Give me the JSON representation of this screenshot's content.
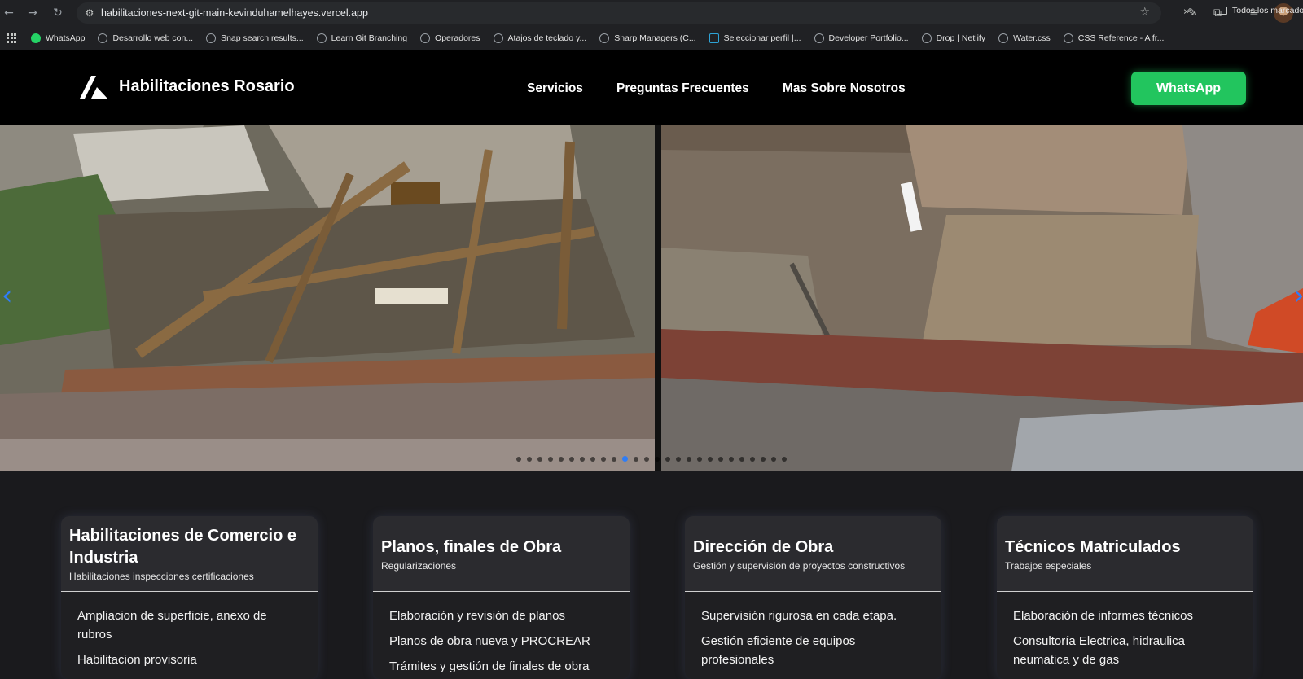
{
  "browser": {
    "url": "habilitaciones-next-git-main-kevinduhamelhayes.vercel.app",
    "bookmarks": [
      {
        "label": "WhatsApp",
        "icon": "whatsapp-icon"
      },
      {
        "label": "Desarrollo web con...",
        "icon": "globe-icon"
      },
      {
        "label": "Snap search results...",
        "icon": "globe-icon"
      },
      {
        "label": "Learn Git Branching",
        "icon": "globe-icon"
      },
      {
        "label": "Operadores",
        "icon": "globe-icon"
      },
      {
        "label": "Atajos de teclado y...",
        "icon": "globe-icon"
      },
      {
        "label": "Sharp Managers (C...",
        "icon": "globe-icon"
      },
      {
        "label": "Seleccionar perfil |...",
        "icon": "tb-icon"
      },
      {
        "label": "Developer Portfolio...",
        "icon": "globe-icon"
      },
      {
        "label": "Drop | Netlify",
        "icon": "globe-icon"
      },
      {
        "label": "Water.css",
        "icon": "globe-icon"
      },
      {
        "label": "CSS Reference - A fr...",
        "icon": "globe-icon"
      }
    ],
    "bookmarks_folder": "Todos los marcadores"
  },
  "site": {
    "brand": "Habilitaciones Rosario",
    "nav": {
      "servicios": "Servicios",
      "faq": "Preguntas Frecuentes",
      "about": "Mas Sobre Nosotros"
    },
    "whatsapp_button": "WhatsApp",
    "accent_color": "#22c55e"
  },
  "carousel": {
    "dot_count": 26,
    "active_dot": 10
  },
  "cards": [
    {
      "title": "Habilitaciones de Comercio e Industria",
      "subtitle": "Habilitaciones inspecciones certificaciones",
      "items": [
        "Ampliacion de superficie, anexo de rubros",
        "Habilitacion provisoria"
      ]
    },
    {
      "title": "Planos, finales de Obra",
      "subtitle": "Regularizaciones",
      "items": [
        "Elaboración y revisión de planos",
        "Planos de obra nueva y PROCREAR",
        "Trámites y gestión de finales de obra"
      ]
    },
    {
      "title": "Dirección de Obra",
      "subtitle": "Gestión y supervisión de proyectos constructivos",
      "items": [
        "Supervisión rigurosa en cada etapa.",
        "Gestión eficiente de equipos profesionales"
      ]
    },
    {
      "title": "Técnicos Matriculados",
      "subtitle": "Trabajos especiales",
      "items": [
        "Elaboración de informes técnicos",
        "Consultoría Electrica, hidraulica neumatica y de gas"
      ]
    }
  ]
}
